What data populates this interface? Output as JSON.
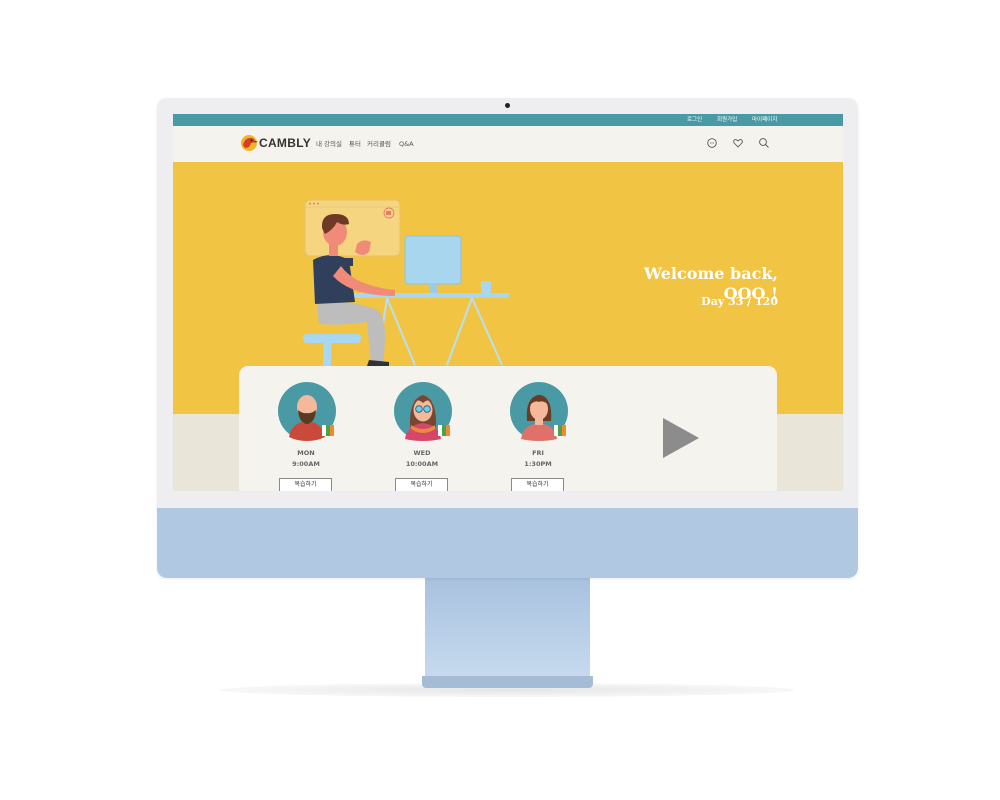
{
  "topbar": {
    "links": [
      "로그인",
      "회원가입",
      "마이페이지"
    ]
  },
  "nav": {
    "logo_text": "CAMBLY",
    "items": [
      "내 강의실",
      "튜터",
      "커리큘럼",
      "Q&A"
    ],
    "icons": [
      "chat-icon",
      "heart-icon",
      "search-icon"
    ]
  },
  "hero": {
    "welcome": "Welcome back, OOO !",
    "day_progress": "Day 33 / 120",
    "background_color": "#f1c443"
  },
  "schedule": {
    "tutors": [
      {
        "day": "MON",
        "time": "9:00AM",
        "button": "복습하기",
        "avatar": "bald-bearded-man-avatar"
      },
      {
        "day": "WED",
        "time": "10:00AM",
        "button": "복습하기",
        "avatar": "woman-with-glasses-avatar"
      },
      {
        "day": "FRI",
        "time": "1:30PM",
        "button": "복습하기",
        "avatar": "woman-ponytail-avatar"
      }
    ],
    "play_icon": "play-icon"
  },
  "colors": {
    "accent": "#4a9aa6",
    "hero": "#f1c443",
    "monitor_chin": "#b0c8e2"
  }
}
